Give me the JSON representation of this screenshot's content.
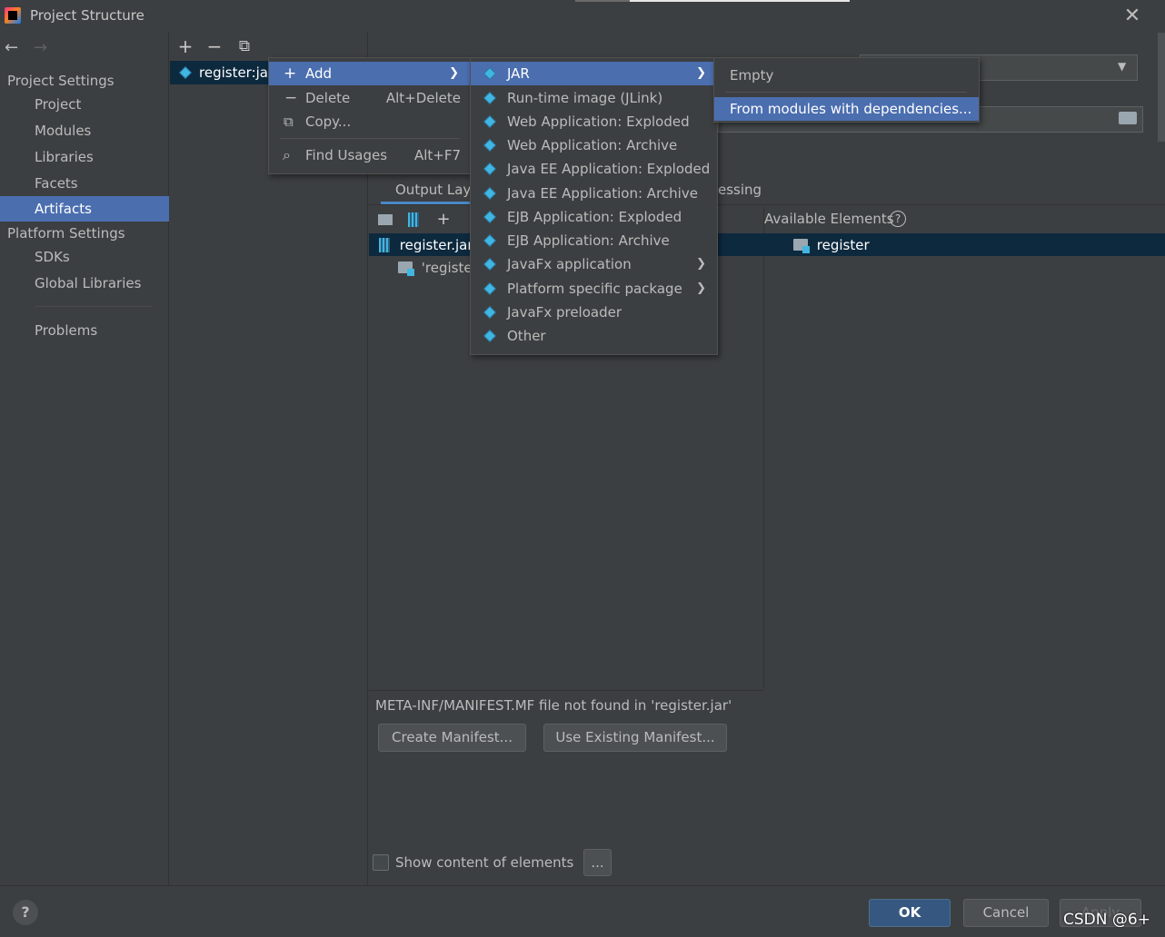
{
  "window": {
    "title": "Project Structure"
  },
  "nav": {
    "back_icon": "←",
    "forward_icon": "→",
    "project_settings_header": "Project Settings",
    "project_items": [
      "Project",
      "Modules",
      "Libraries",
      "Facets",
      "Artifacts"
    ],
    "selected": "Artifacts",
    "platform_settings_header": "Platform Settings",
    "platform_items": [
      "SDKs",
      "Global Libraries"
    ],
    "problems": "Problems"
  },
  "artifact_list": {
    "toolbar": {
      "add": "+",
      "remove": "−",
      "copy": "⧉"
    },
    "items": [
      {
        "label": "register:jar"
      }
    ]
  },
  "detail": {
    "tabs": {
      "output_layout": "Output Layo",
      "post_processing_fragment": "essing"
    },
    "available_elements_label": "Available Elements",
    "help_glyph": "?",
    "output_tree": [
      {
        "label": "register.jar"
      },
      {
        "label": "'register"
      }
    ],
    "available_tree": [
      {
        "label": "register"
      }
    ],
    "manifest": {
      "message": "META-INF/MANIFEST.MF file not found in 'register.jar'",
      "create_button": "Create Manifest...",
      "use_existing_button": "Use Existing Manifest..."
    },
    "show_content": {
      "label": "Show content of elements",
      "checked": false,
      "dots_button": "..."
    }
  },
  "footer": {
    "help": "?",
    "ok": "OK",
    "cancel": "Cancel",
    "apply": "Apply"
  },
  "context_menu": {
    "items": [
      {
        "label": "Add",
        "icon": "plus-icon",
        "selected": true,
        "submenu": true
      },
      {
        "label": "Delete",
        "icon": "minus-icon",
        "shortcut": "Alt+Delete"
      },
      {
        "label": "Copy...",
        "icon": "copy-icon"
      },
      {
        "label": "Find Usages",
        "icon": "search-icon",
        "shortcut": "Alt+F7"
      }
    ]
  },
  "add_submenu": {
    "items": [
      {
        "label": "JAR",
        "selected": true,
        "submenu": true
      },
      {
        "label": "Run-time image (JLink)"
      },
      {
        "label": "Web Application: Exploded"
      },
      {
        "label": "Web Application: Archive"
      },
      {
        "label": "Java EE Application: Exploded"
      },
      {
        "label": "Java EE Application: Archive"
      },
      {
        "label": "EJB Application: Exploded"
      },
      {
        "label": "EJB Application: Archive"
      },
      {
        "label": "JavaFx application",
        "submenu": true
      },
      {
        "label": "Platform specific package",
        "submenu": true
      },
      {
        "label": "JavaFx preloader"
      },
      {
        "label": "Other"
      }
    ]
  },
  "jar_submenu": {
    "items": [
      {
        "label": "Empty"
      },
      {
        "label": "From modules with dependencies...",
        "selected": true
      }
    ]
  },
  "watermark": "CSDN @6+",
  "colors": {
    "background": "#3c3f41",
    "selection": "#4b6eaf",
    "tree_selection": "#0d293e",
    "ok_button": "#365880",
    "icon_blue": "#40b6e0"
  }
}
